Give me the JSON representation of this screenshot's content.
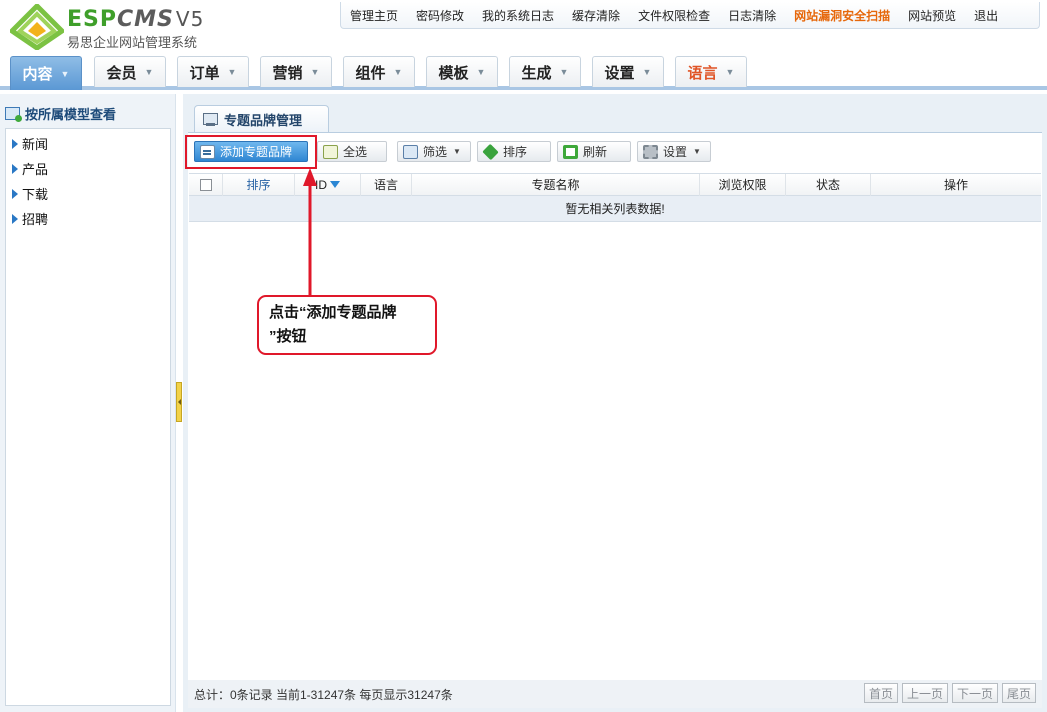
{
  "brand": {
    "logo_espc": "ESP",
    "logo_cms": "CMS",
    "logo_version": "V5",
    "subtitle": "易思企业网站管理系统"
  },
  "topnav": {
    "items": [
      "管理主页",
      "密码修改",
      "我的系统日志",
      "缓存清除",
      "文件权限检查",
      "日志清除",
      "网站漏洞安全扫描",
      "网站预览",
      "退出"
    ]
  },
  "main_tabs": [
    {
      "label": "内容",
      "active": true
    },
    {
      "label": "会员"
    },
    {
      "label": "订单"
    },
    {
      "label": "营销"
    },
    {
      "label": "组件"
    },
    {
      "label": "模板"
    },
    {
      "label": "生成"
    },
    {
      "label": "设置"
    },
    {
      "label": "语言",
      "highlight_color": "#e05527"
    }
  ],
  "sidebar": {
    "title": "按所属模型查看",
    "items": [
      "新闻",
      "产品",
      "下载",
      "招聘"
    ]
  },
  "content": {
    "tab_label": "专题品牌管理",
    "toolbar": {
      "add_label": "添加专题品牌",
      "select_all_label": "全选",
      "filter_label": "筛选",
      "sort_label": "排序",
      "refresh_label": "刷新",
      "settings_label": "设置"
    },
    "table": {
      "columns": [
        "",
        "排序",
        "ID",
        "语言",
        "专题名称",
        "浏览权限",
        "状态",
        "操作"
      ],
      "empty_message": "暂无相关列表数据!"
    },
    "footer": {
      "summary": "总计：0条记录 当前1-31247条 每页显示31247条",
      "pager": [
        "首页",
        "上一页",
        "下一页",
        "尾页"
      ]
    }
  },
  "annotation": {
    "line1": "点击“添加专题品牌",
    "line2": "”按钮",
    "color": "#e0182a"
  }
}
